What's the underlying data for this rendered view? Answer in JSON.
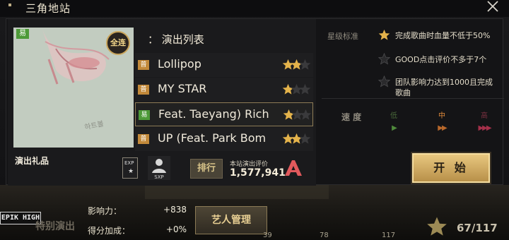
{
  "header": {
    "title": "三角地站"
  },
  "cover": {
    "difficulty": "易",
    "badge": "全连",
    "signature": "하트볼"
  },
  "song_list": {
    "header": "：  演出列表",
    "songs": [
      {
        "difficulty": "普",
        "title": "Lollipop",
        "stars_filled": 2
      },
      {
        "difficulty": "普",
        "title": "MY STAR",
        "stars_filled": 1
      },
      {
        "difficulty": "易",
        "title": "Feat. Taeyang) Rich",
        "stars_filled": 1,
        "selected": true
      },
      {
        "difficulty": "普",
        "title": "UP (Feat. Park Bom",
        "stars_filled": 2
      }
    ]
  },
  "rewards": {
    "label": "演出礼品",
    "exp_badge": "EXP",
    "sxp_badge": "SXP"
  },
  "rank": {
    "button_label": "排行",
    "eval_label": "本站演出评价",
    "eval_value": "1,577,941"
  },
  "star_standard": {
    "label": "星级标准",
    "requirements": [
      {
        "text": "完成歌曲时血量不低于50%",
        "achieved": true
      },
      {
        "text": "GOOD点击评价不多于7个",
        "achieved": false
      },
      {
        "text": "团队影响力达到1000且完成歌曲",
        "achieved": false
      }
    ]
  },
  "speed": {
    "label": "速 度",
    "options": [
      {
        "name": "低",
        "arrows": "▶",
        "color": "#4f8a3c",
        "name_color": "#4a6a3a"
      },
      {
        "name": "中",
        "arrows": "▶▶",
        "color": "#b8682b",
        "name_color": "#e08a3a"
      },
      {
        "name": "高",
        "arrows": "▶▶▶",
        "color": "#a5304a",
        "name_color": "#7a3040"
      }
    ]
  },
  "start_button": {
    "label": "开 始"
  },
  "hud": {
    "logo": "EPIK HIGH",
    "special_text": "特别演出",
    "influence_label": "影响力：",
    "influence_value": "+838",
    "bonus_label": "得分加成：",
    "bonus_value": "+0%",
    "manage_label": "艺人管理",
    "item_counts": [
      "39",
      "78",
      "117"
    ],
    "star_progress": "67/117"
  },
  "colors": {
    "accent_gold": "#e8c77f",
    "easy_green": "#4d9a38",
    "normal_orange": "#c2893a"
  }
}
